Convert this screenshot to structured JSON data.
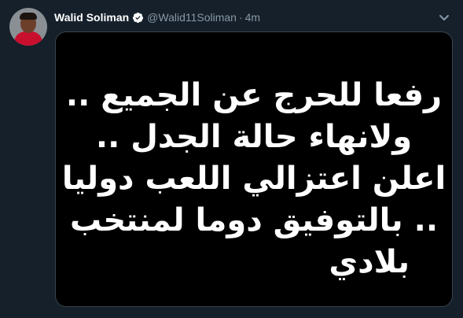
{
  "tweet": {
    "display_name": "Walid Soliman",
    "handle": "@Walid11Soliman",
    "separator": "·",
    "time": "4m",
    "image_text_lines": [
      "رفعا للحرج عن الجميع ..",
      "ولانهاء حالة الجدل ..",
      "اعلن اعتزالي اللعب دوليا",
      ".. بالتوفيق دوما لمنتخب",
      "بلادي"
    ]
  },
  "colors": {
    "background": "#15202b",
    "name": "#ffffff",
    "secondary_text": "#8899a6",
    "verified_badge": "#ffffff",
    "image_background": "#000000",
    "image_text": "#ffffff"
  },
  "icons": {
    "verified": "verified-badge-icon",
    "more": "chevron-down-icon"
  }
}
